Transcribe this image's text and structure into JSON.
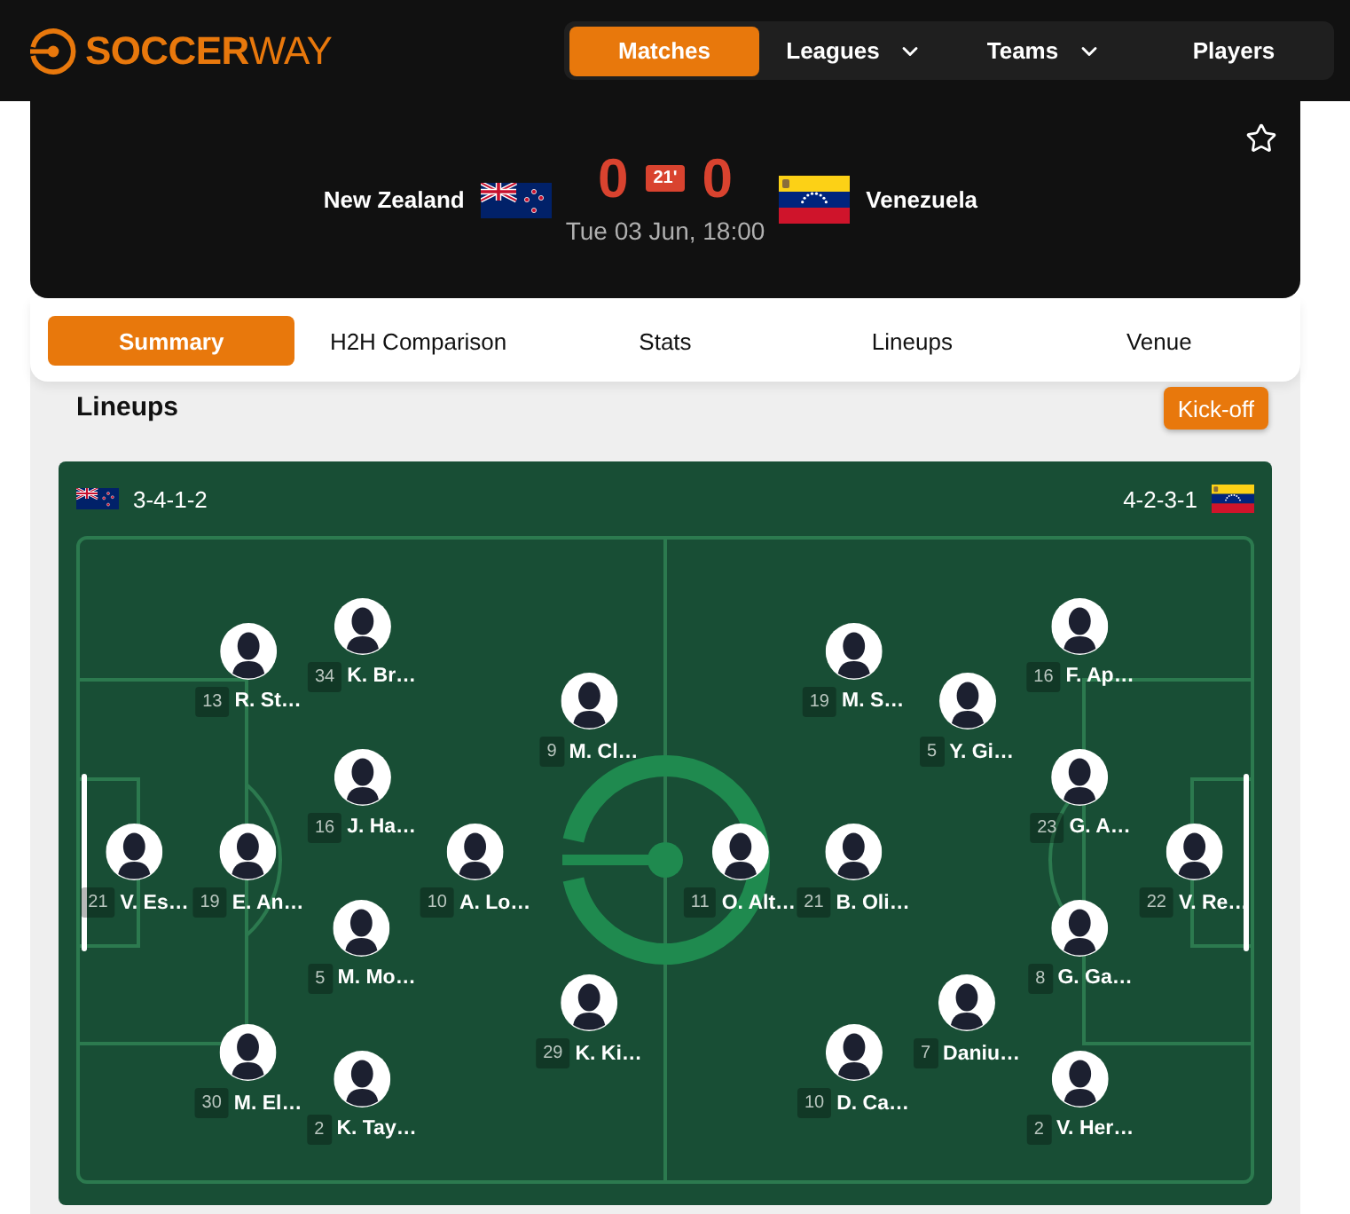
{
  "header": {
    "logo": "**SOCCER**WAY",
    "nav": [
      {
        "label": "Matches",
        "selected": true,
        "dropdown": false
      },
      {
        "label": "Leagues",
        "selected": false,
        "dropdown": true
      },
      {
        "label": "Teams",
        "selected": false,
        "dropdown": true
      },
      {
        "label": "Players",
        "selected": false,
        "dropdown": false
      }
    ]
  },
  "match": {
    "favorite": false,
    "home": {
      "name": "New Zealand",
      "score": "0"
    },
    "minute": "21'",
    "away": {
      "name": "Venezuela",
      "score": "0"
    },
    "kickoff": "Tue 03 Jun, 18:00"
  },
  "tabs": [
    {
      "label": "Summary",
      "selected": true
    },
    {
      "label": "H2H Comparison",
      "selected": false
    },
    {
      "label": "Stats",
      "selected": false
    },
    {
      "label": "Lineups",
      "selected": false
    },
    {
      "label": "Venue",
      "selected": false
    }
  ],
  "lineups": {
    "title": "Lineups",
    "time_button": "Kick-off",
    "home": {
      "formation": "3-4-1-2",
      "lines": [
        [
          {
            "number": "21",
            "name": "V. Es…"
          }
        ],
        [
          {
            "number": "13",
            "name": "R. St…"
          },
          {
            "number": "19",
            "name": "E. An…"
          },
          {
            "number": "30",
            "name": "M. El…"
          }
        ],
        [
          {
            "number": "34",
            "name": "K. Br…"
          },
          {
            "number": "16",
            "name": "J. Ha…"
          },
          {
            "number": "5",
            "name": "M. Mo…"
          },
          {
            "number": "2",
            "name": "K. Tay…"
          }
        ],
        [
          {
            "number": "10",
            "name": "A. Lo…"
          }
        ],
        [
          {
            "number": "9",
            "name": "M. Cl…"
          },
          {
            "number": "29",
            "name": "K. Ki…"
          }
        ]
      ]
    },
    "away": {
      "formation": "4-2-3-1",
      "lines": [
        [
          {
            "number": "11",
            "name": "O. Alt…"
          }
        ],
        [
          {
            "number": "19",
            "name": "M. S…"
          },
          {
            "number": "21",
            "name": "B. Oli…"
          },
          {
            "number": "10",
            "name": "D. Ca…"
          }
        ],
        [
          {
            "number": "5",
            "name": "Y. Gi…"
          },
          {
            "number": "7",
            "name": "Daniu…"
          }
        ],
        [
          {
            "number": "16",
            "name": "F. Ap…"
          },
          {
            "number": "23",
            "name": "G. A…"
          },
          {
            "number": "8",
            "name": "G. Ga…"
          },
          {
            "number": "2",
            "name": "V. Her…"
          }
        ],
        [
          {
            "number": "22",
            "name": "V. Re…"
          }
        ]
      ]
    }
  }
}
